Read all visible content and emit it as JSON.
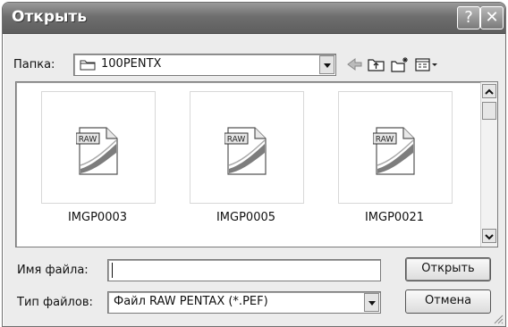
{
  "window": {
    "title": "Открыть"
  },
  "titlebar": {
    "help_glyph": "?",
    "close_glyph": "✕"
  },
  "lookin": {
    "label": "Папка:",
    "value": "100PENTX"
  },
  "toolbar": {
    "icons": [
      "back-arrow-icon",
      "up-folder-icon",
      "new-folder-icon",
      "view-menu-icon"
    ]
  },
  "files": [
    {
      "name": "IMGP0003",
      "badge": "RAW"
    },
    {
      "name": "IMGP0005",
      "badge": "RAW"
    },
    {
      "name": "IMGP0021",
      "badge": "RAW"
    }
  ],
  "filename": {
    "label": "Имя файла:",
    "value": ""
  },
  "filetype": {
    "label": "Тип файлов:",
    "value": "Файл RAW PENTAX (*.PEF)"
  },
  "buttons": {
    "open": "Открыть",
    "cancel": "Отмена"
  }
}
